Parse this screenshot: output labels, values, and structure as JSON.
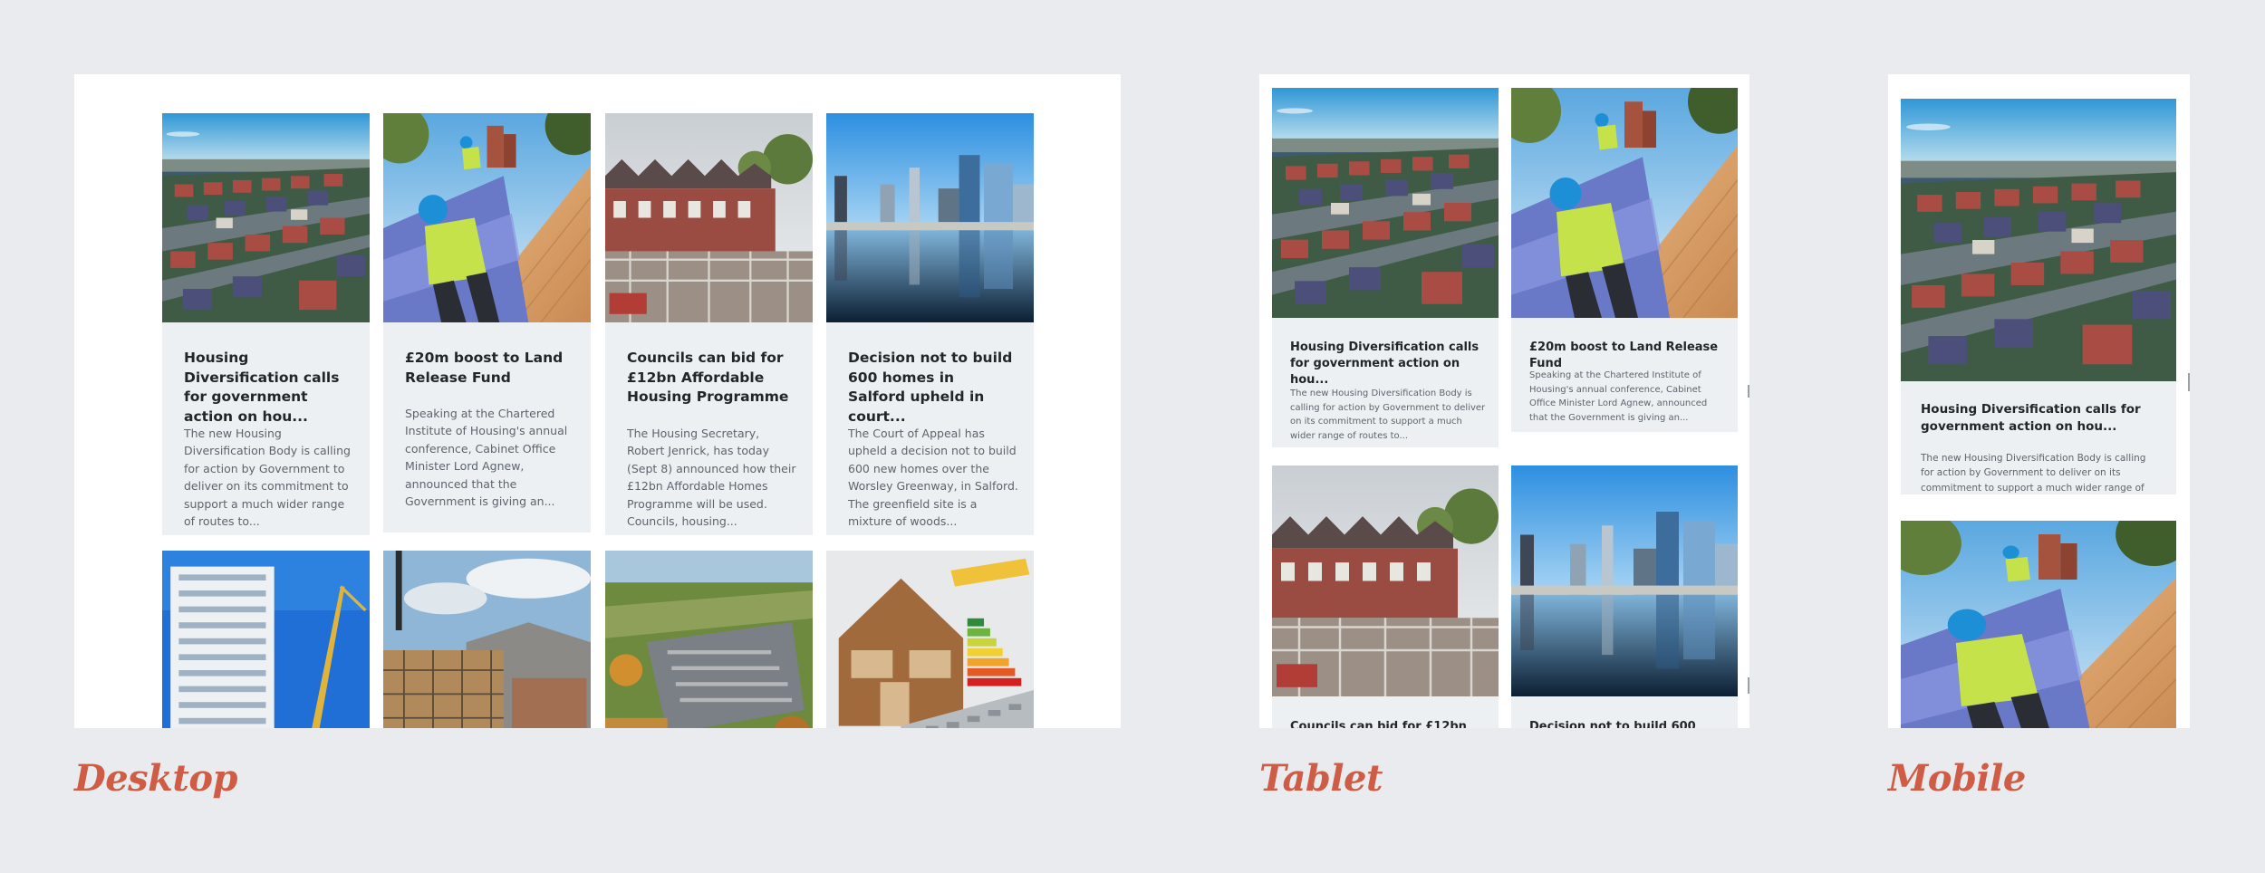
{
  "labels": {
    "desktop": "Desktop",
    "tablet": "Tablet",
    "mobile": "Mobile"
  },
  "colors": {
    "background": "#e9ebee",
    "frame": "#ffffff",
    "card": "#edf0f3",
    "label_accent": "#cf5c45",
    "title_text": "#22262b",
    "body_text": "#5d646c"
  },
  "articles": {
    "a1": {
      "title": "Housing Diversification calls for government action on hou...",
      "excerpt": "The new Housing Diversification Body is calling for action by Government to deliver on its commitment to support a much wider range of routes to...",
      "image": "aerial-housing-estate-image"
    },
    "a2": {
      "title": "£20m boost to Land Release Fund",
      "excerpt": "Speaking at the Chartered Institute of Housing's annual conference, Cabinet Office Minister Lord Agnew, announced that the Government is giving an...",
      "image": "roofer-worker-image"
    },
    "a3": {
      "title": "Councils can bid for £12bn Affordable Housing Programme",
      "tablet_title": "Councils can bid for £12bn",
      "excerpt": "The Housing Secretary, Robert Jenrick, has today (Sept 8) announced how their £12bn Affordable Homes Programme will be used. Councils, housing...",
      "image": "terraced-houses-construction-image"
    },
    "a4": {
      "title": "Decision not to build 600 homes in Salford upheld in court...",
      "tablet_title": "Decision not to build 600 homes",
      "excerpt": "The Court of Appeal has upheld a decision not to build 600 new homes over the Worsley Greenway, in Salford. The greenfield site is a mixture of woods...",
      "image": "salford-waterfront-image"
    },
    "a5": {
      "image": "tower-block-crane-image"
    },
    "a6": {
      "image": "scaffolded-building-image"
    },
    "a7": {
      "image": "aerial-town-image"
    },
    "a8": {
      "image": "energy-rating-house-image"
    }
  }
}
